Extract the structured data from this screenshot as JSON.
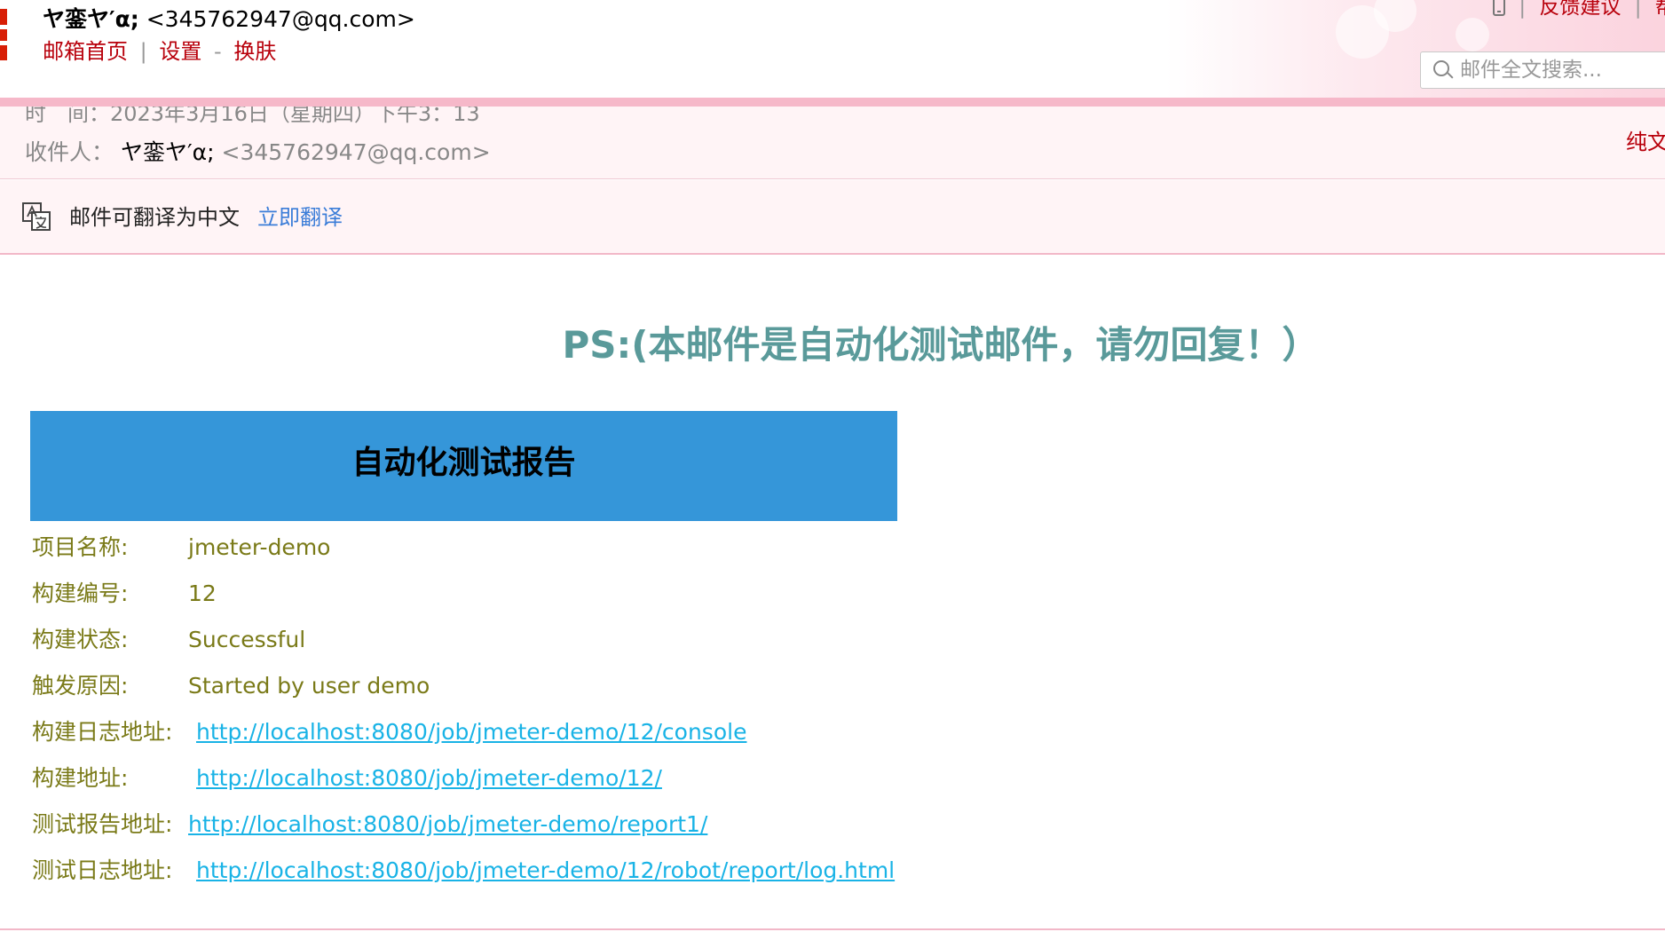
{
  "header": {
    "account_nick": "ヤ銮ヤ′α;",
    "account_email": "<345762947@qq.com>",
    "nav": [
      "邮箱首页",
      "设置",
      "换肤"
    ],
    "nav_sep1": "|",
    "nav_sep2": "-",
    "top_links": [
      "反馈建议",
      "帮"
    ],
    "top_sep": "|",
    "search_placeholder": "邮件全文搜索..."
  },
  "mail_info": {
    "time_text": "时　间：2023年3月16日（星期四）下午3：13",
    "to_label": "收件人：",
    "to_name": "ヤ銮ヤ′α;",
    "to_email": "<345762947@qq.com>",
    "plain_text_link": "纯文"
  },
  "translate": {
    "icon": "translate-icon",
    "text": "邮件可翻译为中文",
    "link": "立即翻译"
  },
  "body": {
    "ps_text": "PS:(本邮件是自动化测试邮件，请勿回复！）",
    "report_title": "自动化测试报告",
    "rows": [
      {
        "label": "项目名称:",
        "value": "jmeter-demo"
      },
      {
        "label": "构建编号:",
        "value": "12"
      },
      {
        "label": "构建状态:",
        "value": "Successful"
      },
      {
        "label": "触发原因:",
        "value": "Started by user demo"
      },
      {
        "label": "构建日志地址:",
        "value": "http://localhost:8080/job/jmeter-demo/12/console"
      },
      {
        "label": "构建地址:",
        "value": "http://localhost:8080/job/jmeter-demo/12/"
      },
      {
        "label": "测试报告地址:",
        "value": "http://localhost:8080/job/jmeter-demo/report1/"
      },
      {
        "label": "测试日志地址:",
        "value": "http://localhost:8080/job/jmeter-demo/12/robot/report/log.html"
      }
    ]
  },
  "colors": {
    "accent_red": "#b8000b",
    "banner_blue": "#3596d9",
    "ps_teal": "#5a9a9a",
    "row_olive": "#7a7a18",
    "link_blue": "#19b3e6",
    "pink_bar": "#f6b8c9"
  }
}
